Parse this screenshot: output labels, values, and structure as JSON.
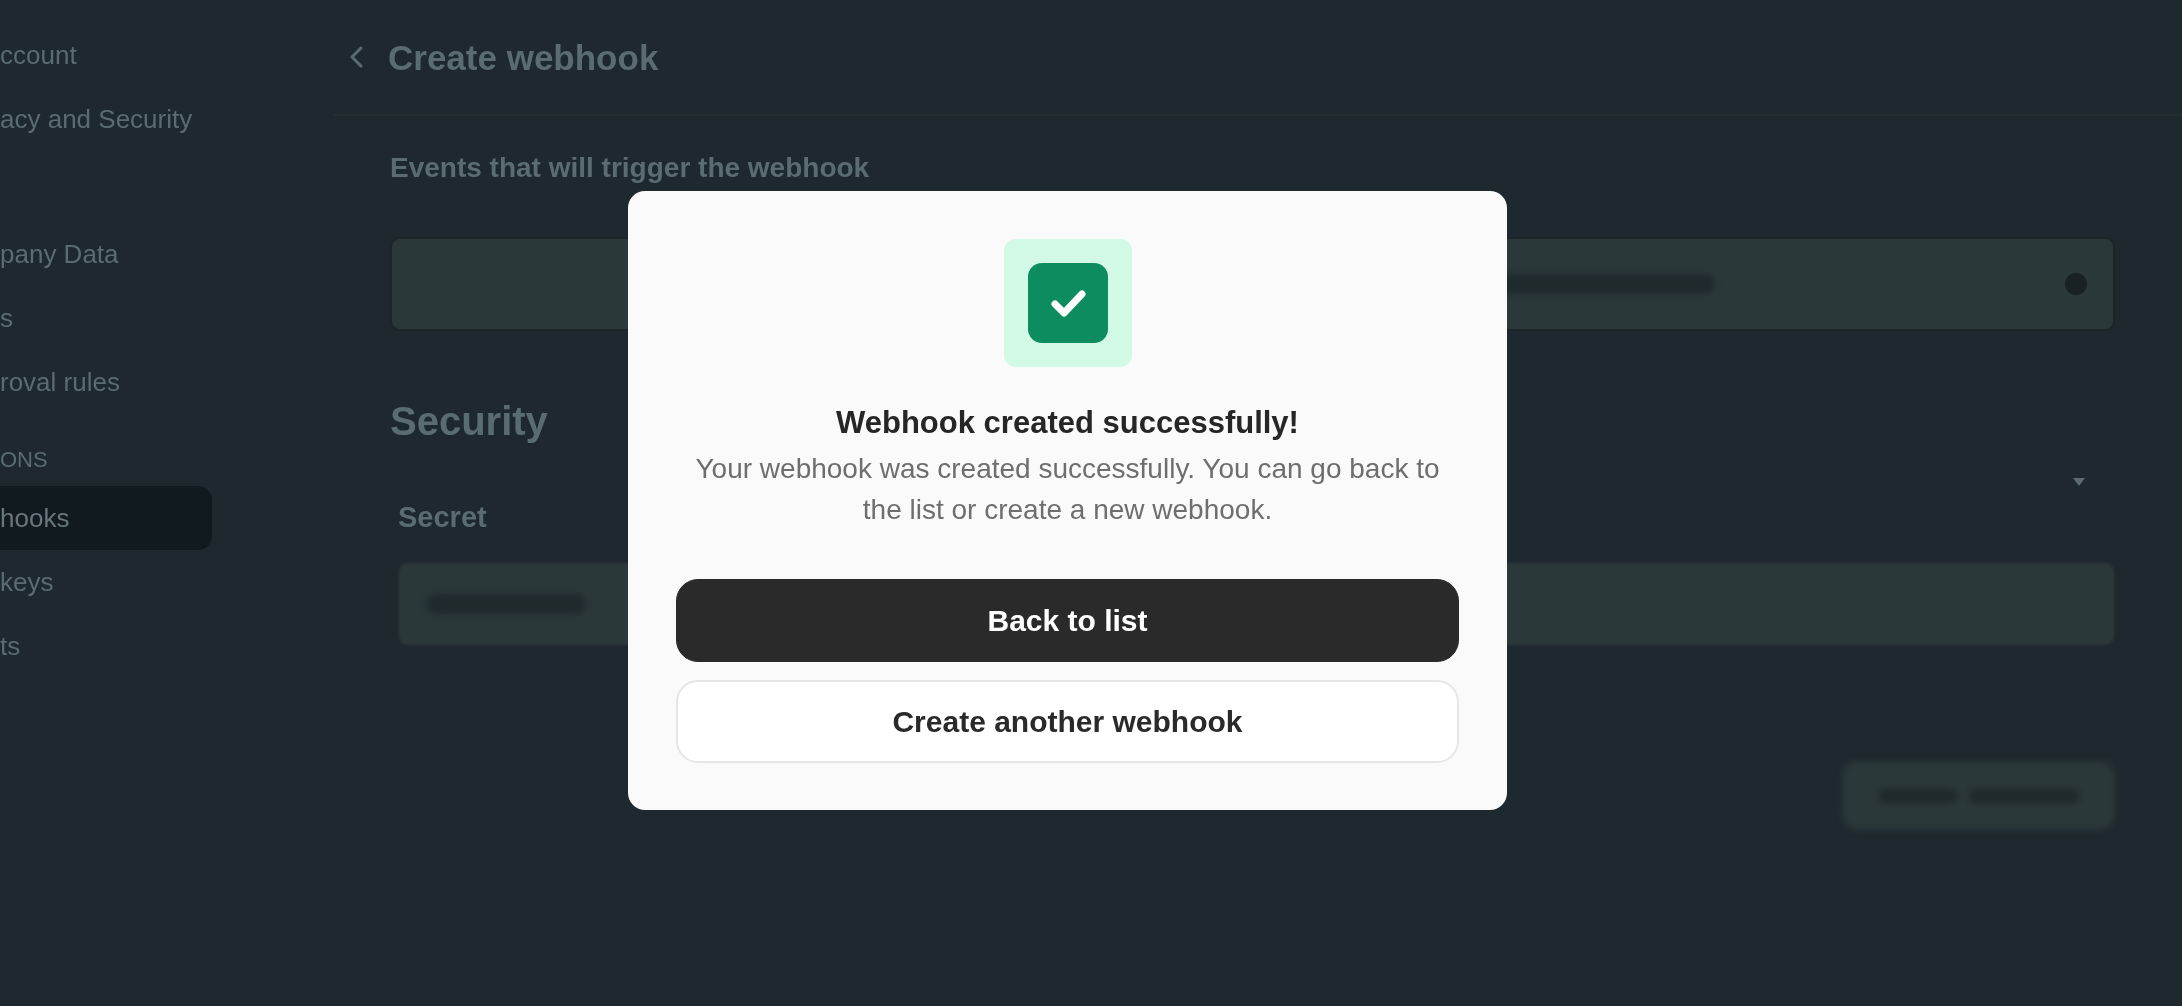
{
  "sidebar": {
    "groups": [
      {
        "items": [
          {
            "label": "ccount",
            "selected": false
          },
          {
            "label": "acy and Security",
            "selected": false
          }
        ]
      },
      {
        "items": [
          {
            "label": "pany Data",
            "selected": false
          },
          {
            "label": "s",
            "selected": false
          },
          {
            "label": "roval rules",
            "selected": false
          }
        ]
      },
      {
        "label": "ONS",
        "items": [
          {
            "label": "hooks",
            "selected": true
          },
          {
            "label": "keys",
            "selected": false
          },
          {
            "label": "ts",
            "selected": false
          }
        ]
      }
    ]
  },
  "page": {
    "title": "Create webhook",
    "events": {
      "heading": "Events that will trigger the webhook"
    },
    "security": {
      "heading": "Security",
      "secret_label": "Secret"
    }
  },
  "dialog": {
    "title": "Webhook created successfully!",
    "message": "Your webhook was created successfully. You can go back to the list or create a new webhook.",
    "buttons": [
      {
        "label": "Back to list",
        "kind": "primary"
      },
      {
        "label": "Create another webhook",
        "kind": "secondary"
      }
    ]
  }
}
